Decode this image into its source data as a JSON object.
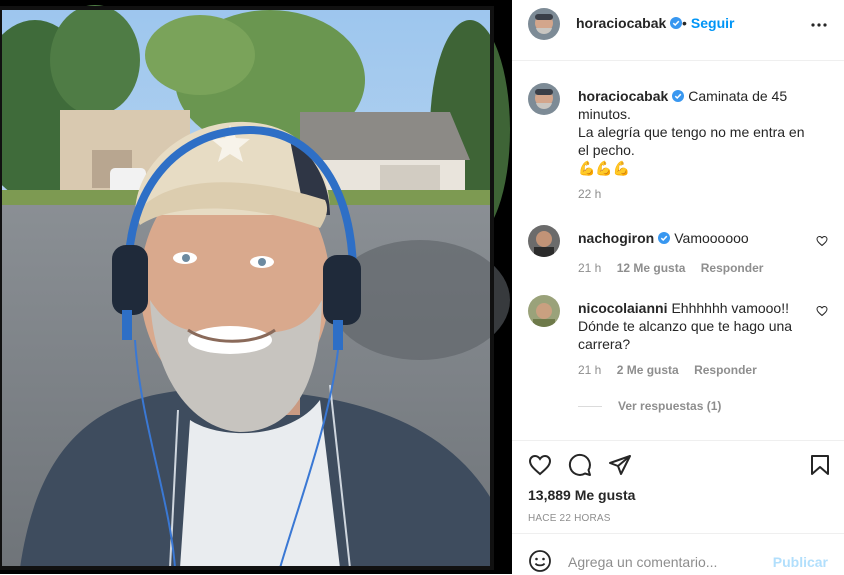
{
  "post": {
    "author": "horaciocabak",
    "follow_label": "Seguir",
    "dot": "•"
  },
  "caption": {
    "username": "horaciocabak",
    "text": "Caminata de 45 minutos.",
    "line2": "La alegría que tengo no me entra en el pecho.",
    "emojis": "💪💪💪",
    "time": "22 h"
  },
  "comments": [
    {
      "username": "nachogiron",
      "verified": true,
      "text": "Vamoooooo",
      "time": "21 h",
      "likes": "12 Me gusta",
      "reply": "Responder"
    },
    {
      "username": "nicocolaianni",
      "verified": false,
      "text": "Ehhhhhh vamooo!! Dónde te alcanzo que te hago una carrera?",
      "time": "21 h",
      "likes": "2 Me gusta",
      "reply": "Responder"
    }
  ],
  "view_replies": "Ver respuestas (1)",
  "likes_count": "13,889 Me gusta",
  "posted_ago": "HACE 22 HORAS",
  "add_comment": {
    "placeholder": "Agrega un comentario...",
    "publish_label": "Publicar"
  },
  "colors": {
    "link_blue": "#0095f6",
    "verified_blue": "#3897f0",
    "muted": "#8e8e8e",
    "publish_disabled": "#b2dffc"
  },
  "icons": [
    "verified-badge-icon",
    "more-options-icon",
    "heart-icon",
    "comment-icon",
    "share-icon",
    "save-icon",
    "emoji-icon"
  ]
}
